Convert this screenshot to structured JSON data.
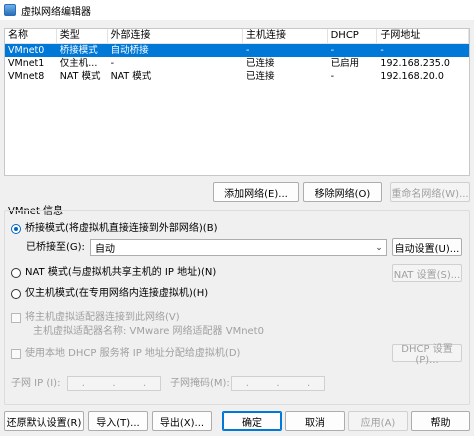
{
  "window": {
    "title": "虚拟网络编辑器"
  },
  "table": {
    "headers": [
      "名称",
      "类型",
      "外部连接",
      "主机连接",
      "DHCP",
      "子网地址"
    ],
    "rows": [
      [
        "VMnet0",
        "桥接模式",
        "自动桥接",
        "-",
        "-",
        "-"
      ],
      [
        "VMnet1",
        "仅主机...",
        "-",
        "已连接",
        "已启用",
        "192.168.235.0"
      ],
      [
        "VMnet8",
        "NAT 模式",
        "NAT 模式",
        "已连接",
        "-",
        "192.168.20.0"
      ]
    ],
    "selected_index": 0
  },
  "table_buttons": {
    "add": "添加网络(E)...",
    "remove": "移除网络(O)",
    "rename": "重命名网络(W)..."
  },
  "vmnet_info": {
    "heading": "VMnet 信息",
    "bridge_radio": "桥接模式(将虚拟机直接连接到外部网络)(B)",
    "bridged_to_label": "已桥接至(G):",
    "bridged_to_value": "自动",
    "auto_settings": "自动设置(U)...",
    "nat_radio": "NAT 模式(与虚拟机共享主机的 IP 地址)(N)",
    "nat_settings": "NAT 设置(S)...",
    "hostonly_radio": "仅主机模式(在专用网络内连接虚拟机)(H)",
    "connect_adapter": "将主机虚拟适配器连接到此网络(V)",
    "adapter_name": "主机虚拟适配器名称: VMware 网络适配器 VMnet0",
    "dhcp_check": "使用本地 DHCP 服务将 IP 地址分配给虚拟机(D)",
    "dhcp_settings": "DHCP 设置(P)...",
    "subnet_ip_label": "子网 IP (I):",
    "subnet_mask_label": "子网掩码(M):",
    "ip_dots": "."
  },
  "footer": {
    "restore": "还原默认设置(R)",
    "import": "导入(T)...",
    "export": "导出(X)...",
    "ok": "确定",
    "cancel": "取消",
    "apply": "应用(A)",
    "help": "帮助"
  }
}
